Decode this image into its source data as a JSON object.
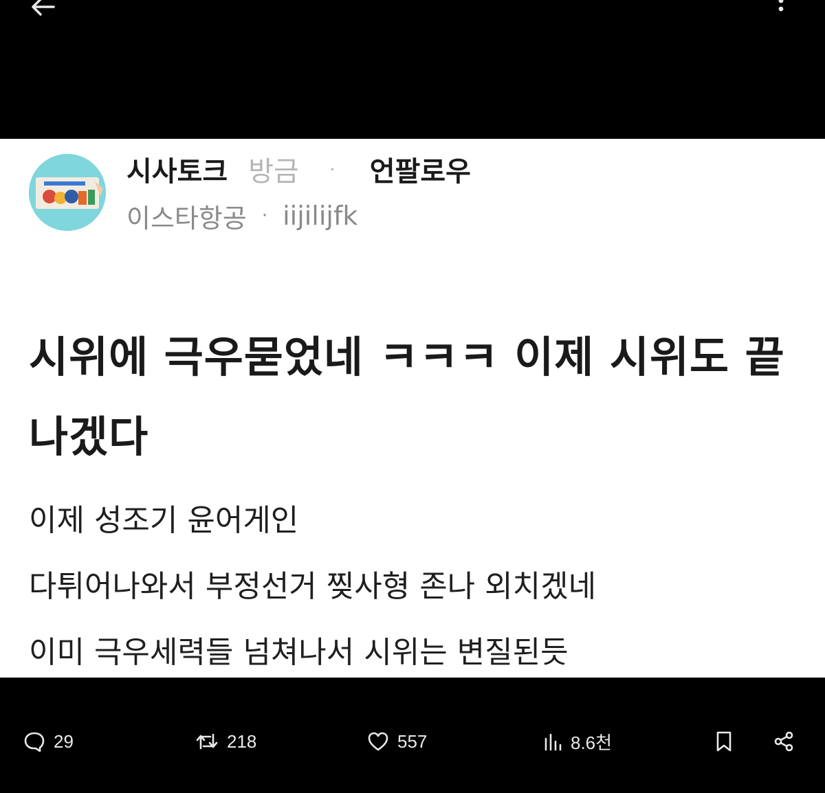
{
  "post": {
    "board": "시사토크",
    "time": "방금",
    "username": "언팔로우",
    "affiliation": "이스타항공",
    "handle": "iijilijfk",
    "title": "시위에 극우묻었네 ㅋㅋㅋ 이제 시위도 끝나겠다",
    "body": [
      "이제 성조기 윤어게인",
      "다튀어나와서 부정선거 찢사형 존나 외치겠네",
      "이미 극우세력들 넘쳐나서 시위는 변질된듯"
    ]
  },
  "actions": {
    "replies": "29",
    "reposts": "218",
    "likes": "557",
    "views": "8.6천"
  },
  "icons": {
    "back": "arrow-left-icon",
    "more": "more-vertical-icon",
    "reply": "chat-bubble-icon",
    "repost": "repost-icon",
    "like": "heart-icon",
    "views": "bar-chart-icon",
    "bookmark": "bookmark-icon",
    "share": "share-icon"
  },
  "colors": {
    "background": "#000000",
    "card": "#ffffff",
    "action_text": "#e7e9ea",
    "avatar": "#7fd6dc"
  }
}
